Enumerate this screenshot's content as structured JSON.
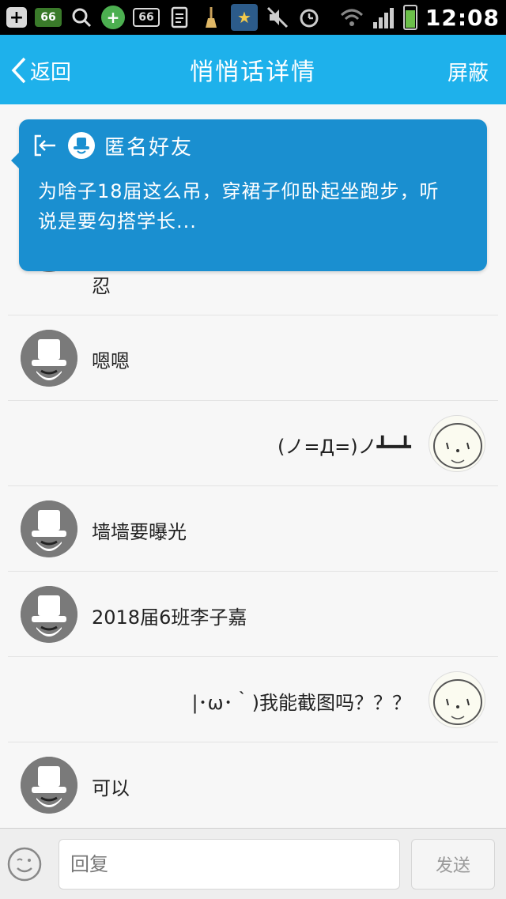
{
  "status_bar": {
    "time": "12:08",
    "icons": [
      "plus-icon",
      "sixty-six-badge-icon",
      "search-icon",
      "green-plus-icon",
      "sixty-six-box-icon",
      "document-icon",
      "broom-icon",
      "star-icon",
      "mute-icon",
      "alarm-icon",
      "wifi-icon",
      "signal-icon",
      "battery-icon"
    ],
    "badge_66": "66"
  },
  "header": {
    "back_label": "返回",
    "title": "悄悄话详情",
    "block_label": "屏蔽",
    "color": "#1eb1eb"
  },
  "card": {
    "sender": "匿名好友",
    "text": "为啥子18届这么吊，穿裙子仰卧起坐跑步，听说是要勾搭学长...",
    "color": "#1a8fd0"
  },
  "messages": [
    {
      "side": "left",
      "text": "忍"
    },
    {
      "side": "left",
      "text": "嗯嗯"
    },
    {
      "side": "right",
      "text": "(ノ=Д=)ノ┻━┻"
    },
    {
      "side": "left",
      "text": "墙墙要曝光"
    },
    {
      "side": "left",
      "text": "2018届6班李子嘉"
    },
    {
      "side": "right",
      "text": "|･ω･｀)我能截图吗？？？"
    },
    {
      "side": "left",
      "text": "可以"
    }
  ],
  "input_bar": {
    "placeholder": "回复",
    "send_label": "发送"
  }
}
